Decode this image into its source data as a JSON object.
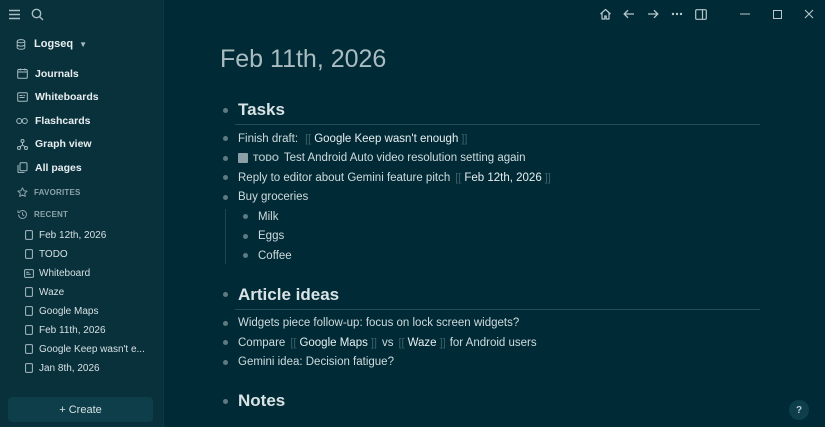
{
  "sidebar": {
    "graph_name": "Logseq",
    "nav": [
      {
        "label": "Journals",
        "icon": "calendar-icon"
      },
      {
        "label": "Whiteboards",
        "icon": "whiteboard-icon"
      },
      {
        "label": "Flashcards",
        "icon": "infinity-icon"
      },
      {
        "label": "Graph view",
        "icon": "hierarchy-icon"
      },
      {
        "label": "All pages",
        "icon": "files-icon"
      }
    ],
    "favorites_label": "FAVORITES",
    "recent_label": "RECENT",
    "recent": [
      {
        "label": "Feb 12th, 2026",
        "icon": "page-icon"
      },
      {
        "label": "TODO",
        "icon": "page-icon"
      },
      {
        "label": "Whiteboard",
        "icon": "whiteboard-icon"
      },
      {
        "label": "Waze",
        "icon": "page-icon"
      },
      {
        "label": "Google Maps",
        "icon": "page-icon"
      },
      {
        "label": "Feb 11th, 2026",
        "icon": "page-icon"
      },
      {
        "label": "Google Keep wasn't e...",
        "icon": "page-icon"
      },
      {
        "label": "Jan 8th, 2026",
        "icon": "page-icon"
      }
    ],
    "create_label": "+ Create"
  },
  "page": {
    "title": "Feb 11th, 2026",
    "sections": {
      "tasks": {
        "heading": "Tasks",
        "b1_text": "Finish draft:",
        "b1_ref": "Google Keep wasn't enough",
        "b2_marker": "TODO",
        "b2_text": "Test Android Auto video resolution setting again",
        "b3_text": "Reply to editor about Gemini feature pitch",
        "b3_ref": "Feb 12th, 2026",
        "b4_text": "Buy groceries",
        "groceries": [
          "Milk",
          "Eggs",
          "Coffee"
        ]
      },
      "articles": {
        "heading": "Article ideas",
        "a1_text": "Widgets piece follow-up: focus on lock screen widgets?",
        "a2_pre": "Compare",
        "a2_ref1": "Google Maps",
        "a2_mid": "vs",
        "a2_ref2": "Waze",
        "a2_post": "for Android users",
        "a3_text": "Gemini idea: Decision fatigue?"
      },
      "notes": {
        "heading": "Notes"
      }
    }
  },
  "help_label": "?"
}
